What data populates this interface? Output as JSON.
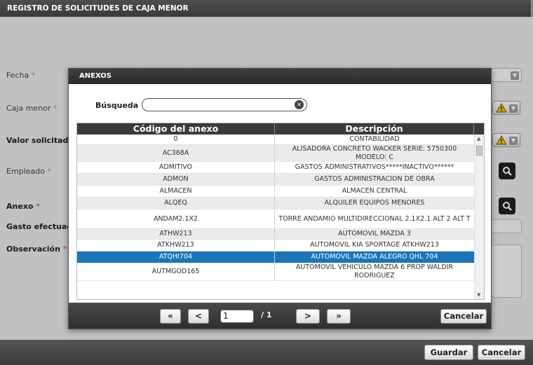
{
  "window": {
    "title": "REGISTRO DE SOLICITUDES DE CAJA MENOR"
  },
  "form": {
    "fecha_label": "Fecha",
    "caja_menor_label": "Caja menor",
    "valor_solicitado_label": "Valor solicitado",
    "empleado_label": "Empleado",
    "anexo_label": "Anexo",
    "gasto_efectuado_label": "Gasto efectuad",
    "observacion_label": "Observación",
    "required_mark": "*"
  },
  "footer": {
    "save_label": "Guardar",
    "cancel_label": "Cancelar"
  },
  "modal": {
    "title": "ANEXOS",
    "search_label": "Búsqueda",
    "search_value": "",
    "columns": [
      "Código del anexo",
      "Descripción"
    ],
    "rows": [
      {
        "code": "0",
        "desc": "CONTABILIDAD"
      },
      {
        "code": "AC368A",
        "desc": "ALISADORA CONCRETO WACKER SERIE: 5750300 MODELO: C"
      },
      {
        "code": "ADMITIVO",
        "desc": "GASTOS ADMINISTRATIVOS*****INACTIVO******"
      },
      {
        "code": "ADMON",
        "desc": "GASTOS ADMINISTRACION DE OBRA"
      },
      {
        "code": "ALMACEN",
        "desc": "ALMACEN CENTRAL"
      },
      {
        "code": "ALQEQ",
        "desc": "ALQUILER EQUIPOS MENORES"
      },
      {
        "code": "ANDAM2.1X2",
        "desc": "TORRE ANDAMIO MULTIDIRECCIONAL 2.1X2.1 ALT 2 ALT T"
      },
      {
        "code": "ATHW213",
        "desc": "AUTOMOVIL MAZDA 3"
      },
      {
        "code": "ATKHW213",
        "desc": "AUTOMOVIL KIA SPORTAGE ATKHW213"
      },
      {
        "code": "ATQHI704",
        "desc": "AUTOMOVIL MAZDA ALEGRO QHL 704"
      },
      {
        "code": "AUTMGOD165",
        "desc": "AUTOMOVIL VEHICULO MAZDA 6 PROP WALDIR RODRIGUEZ"
      }
    ],
    "selected_index": 9,
    "pager": {
      "first": "«",
      "prev": "<",
      "page": "1",
      "total": "/ 1",
      "next": ">",
      "last": "»"
    },
    "cancel_label": "Cancelar"
  },
  "colors": {
    "selected_row": "#1a75bb",
    "required": "#e36a6a",
    "title_bar": "#3b3b3b"
  },
  "icons": {
    "warning": "warning-icon",
    "search": "search-icon",
    "clear": "clear-icon"
  }
}
